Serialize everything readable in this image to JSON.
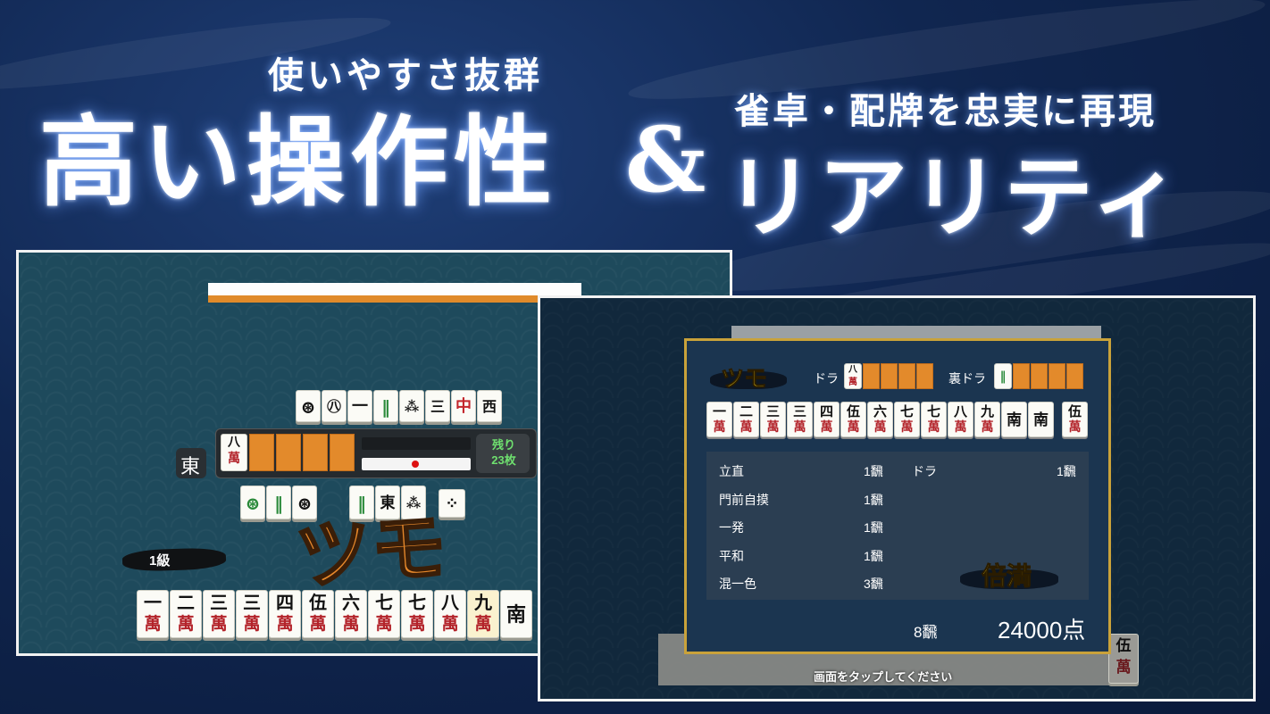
{
  "headline": {
    "sub_left": "使いやすさ抜群",
    "main_left": "高い操作性",
    "amp": "&",
    "sub_right": "雀卓・配牌を忠実に再現",
    "main_right": "リアリティ"
  },
  "left_screen": {
    "seat_wind": "東",
    "dora_indicator": {
      "top": "八",
      "bottom": "萬"
    },
    "remaining": "残り\n23枚",
    "rank": "1級",
    "call_text": "ツモ",
    "discards_top": [
      "⊛",
      "㊇",
      "一",
      "‖",
      "⁂",
      "三",
      "中",
      "西"
    ],
    "discards_bottom": [
      "⊛",
      "‖",
      "⊛",
      "‖",
      "東",
      "⁂",
      "⁘"
    ],
    "hand": [
      {
        "t": "一",
        "m": "萬"
      },
      {
        "t": "二",
        "m": "萬"
      },
      {
        "t": "三",
        "m": "萬"
      },
      {
        "t": "三",
        "m": "萬"
      },
      {
        "t": "四",
        "m": "萬"
      },
      {
        "t": "伍",
        "m": "萬"
      },
      {
        "t": "六",
        "m": "萬"
      },
      {
        "t": "七",
        "m": "萬"
      },
      {
        "t": "七",
        "m": "萬"
      },
      {
        "t": "八",
        "m": "萬"
      },
      {
        "t": "九",
        "m": "萬"
      },
      {
        "t": "南",
        "m": ""
      }
    ]
  },
  "result_screen": {
    "win_type": "ツモ",
    "dora_label": "ドラ",
    "dora_tile": {
      "top": "八",
      "bottom": "萬"
    },
    "ura_dora_label": "裏ドラ",
    "hand": [
      {
        "t": "一",
        "m": "萬"
      },
      {
        "t": "二",
        "m": "萬"
      },
      {
        "t": "三",
        "m": "萬"
      },
      {
        "t": "三",
        "m": "萬"
      },
      {
        "t": "四",
        "m": "萬"
      },
      {
        "t": "伍",
        "m": "萬"
      },
      {
        "t": "六",
        "m": "萬"
      },
      {
        "t": "七",
        "m": "萬"
      },
      {
        "t": "七",
        "m": "萬"
      },
      {
        "t": "八",
        "m": "萬"
      },
      {
        "t": "九",
        "m": "萬"
      },
      {
        "t": "南",
        "m": ""
      },
      {
        "t": "南",
        "m": ""
      }
    ],
    "winning_tile": {
      "t": "伍",
      "m": "萬"
    },
    "yaku_left": [
      {
        "name": "立直",
        "han": "1飜"
      },
      {
        "name": "門前自摸",
        "han": "1飜"
      },
      {
        "name": "一発",
        "han": "1飜"
      },
      {
        "name": "平和",
        "han": "1飜"
      },
      {
        "name": "混一色",
        "han": "3飜"
      }
    ],
    "yaku_right": [
      {
        "name": "ドラ",
        "han": "1飜"
      }
    ],
    "limit_name": "倍満",
    "total_han": "8飜",
    "points": "24000点",
    "tap_prompt": "画面をタップしてください"
  },
  "colors": {
    "accent": "#e08a2a",
    "frame_gold": "#c9a23a",
    "bg": "#102650"
  }
}
